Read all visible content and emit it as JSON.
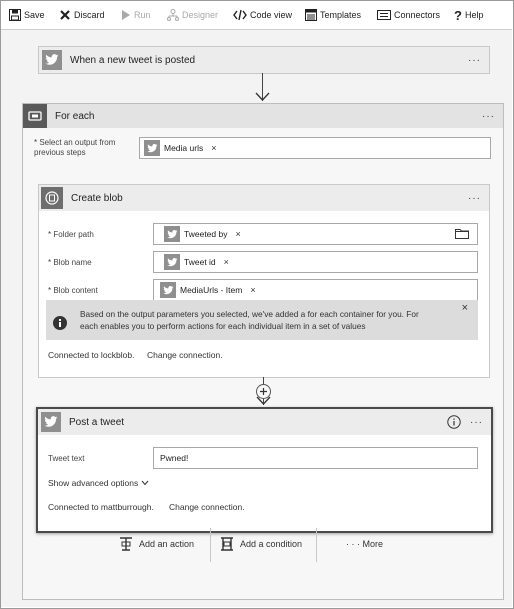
{
  "toolbar": {
    "save": "Save",
    "discard": "Discard",
    "run": "Run",
    "designer": "Designer",
    "code_view": "Code view",
    "templates": "Templates",
    "connectors": "Connectors",
    "help": "Help"
  },
  "trigger": {
    "title": "When a new tweet is posted",
    "menu": "···"
  },
  "foreach": {
    "title": "For each",
    "menu": "···",
    "select_label_line1": "* Select an output from",
    "select_label_line2": "previous steps",
    "select_token": "Media urls",
    "create_blob": {
      "title": "Create blob",
      "menu": "···",
      "folder_label": "* Folder path",
      "folder_token": "Tweeted by",
      "name_label": "* Blob name",
      "name_token": "Tweet id",
      "content_label": "* Blob content",
      "content_token": "MediaUrls - Item",
      "info_line1": "Based on the output parameters you selected, we've added a for each container for you. For",
      "info_line2": "each enables you to perform actions for each individual item in a set of values",
      "info_close": "×",
      "connected": "Connected to lockblob.",
      "change": "Change connection."
    }
  },
  "post": {
    "title": "Post a tweet",
    "menu": "···",
    "tweet_label": "Tweet text",
    "tweet_value": "Pwned!",
    "advanced": "Show advanced options",
    "connected": "Connected to mattburrough.",
    "change": "Change connection."
  },
  "bottom": {
    "add_action": "Add an action",
    "add_condition": "Add a condition",
    "more": "· · · More"
  },
  "token_remove": "×"
}
